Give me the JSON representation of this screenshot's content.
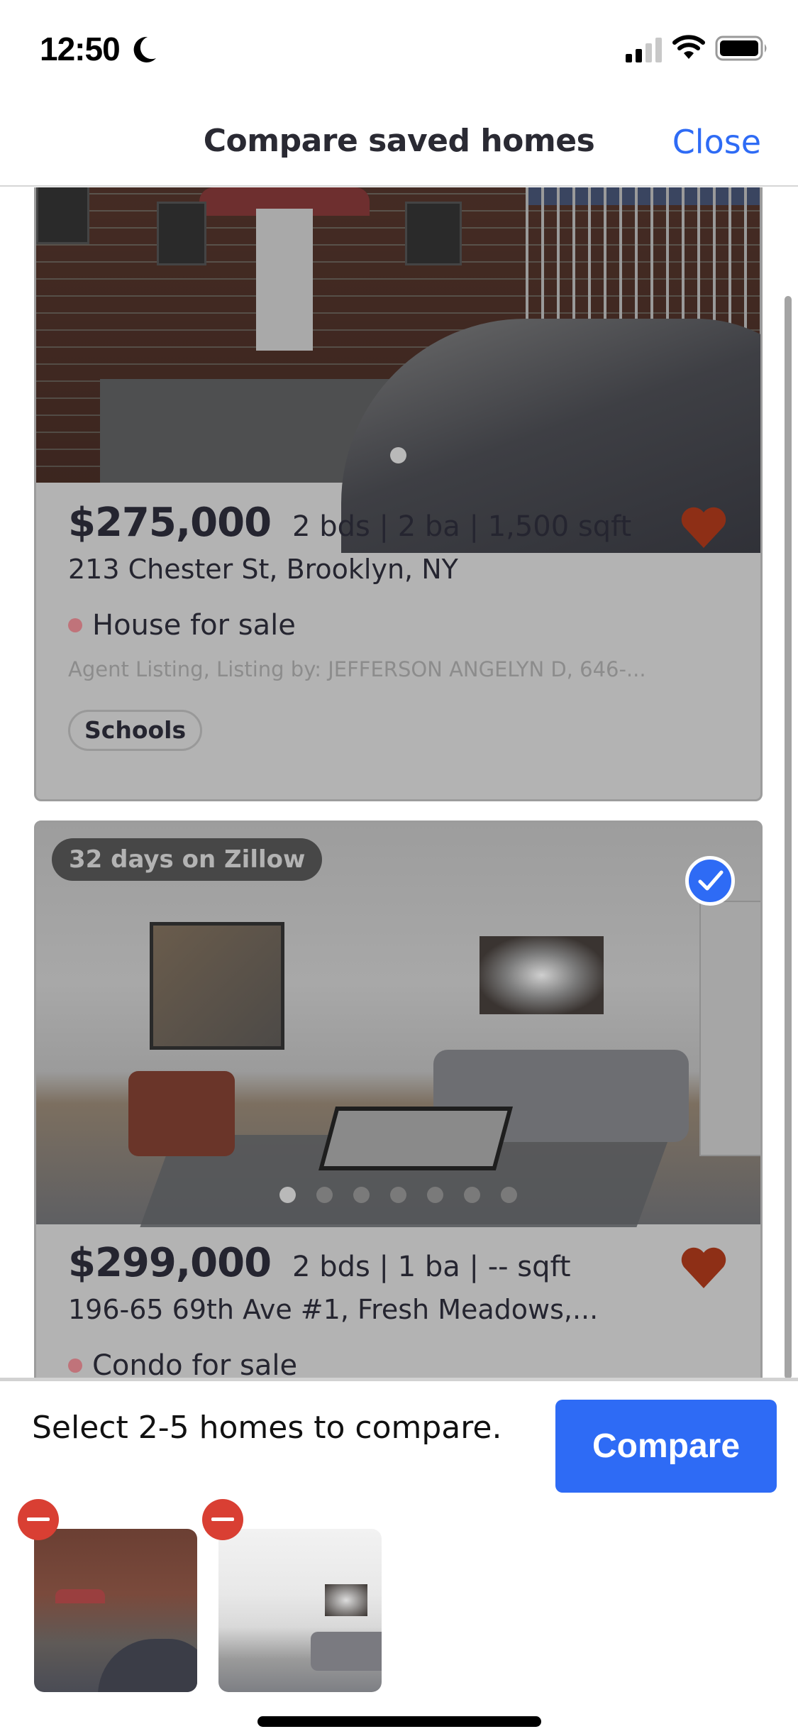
{
  "status_bar": {
    "time": "12:50",
    "focus_icon": "moon-icon",
    "signal_bars_filled": 2,
    "signal_bars_total": 4,
    "wifi_icon": "wifi-icon",
    "battery_icon": "battery-icon"
  },
  "header": {
    "title": "Compare saved homes",
    "close_label": "Close"
  },
  "listings": [
    {
      "price": "$275,000",
      "specs": "2 bds | 2 ba | 1,500 sqft",
      "address": "213 Chester St, Brooklyn, NY",
      "status": "House for sale",
      "agent": "Agent Listing, Listing by: JEFFERSON ANGELYN D, 646-...",
      "tags": [
        "Schools"
      ],
      "saved": true,
      "photo_count": 1,
      "active_photo": 1
    },
    {
      "badge": "32 days on Zillow",
      "selected": true,
      "price": "$299,000",
      "specs": "2 bds | 1 ba | -- sqft",
      "address": "196-65 69th Ave #1, Fresh Meadows,...",
      "status": "Condo for sale",
      "saved": true,
      "photo_count": 7,
      "active_photo": 1
    }
  ],
  "bottom_panel": {
    "instruction": "Select 2-5 homes to compare.",
    "compare_label": "Compare",
    "selected_thumbnails": [
      {
        "name": "213 Chester St",
        "remove_icon": "minus-circle-icon"
      },
      {
        "name": "196-65 69th Ave #1",
        "remove_icon": "minus-circle-icon"
      }
    ]
  },
  "colors": {
    "accent": "#2e6bf5",
    "heart": "#8e2f16",
    "remove": "#d93f33",
    "status_dot": "#c0737a"
  }
}
